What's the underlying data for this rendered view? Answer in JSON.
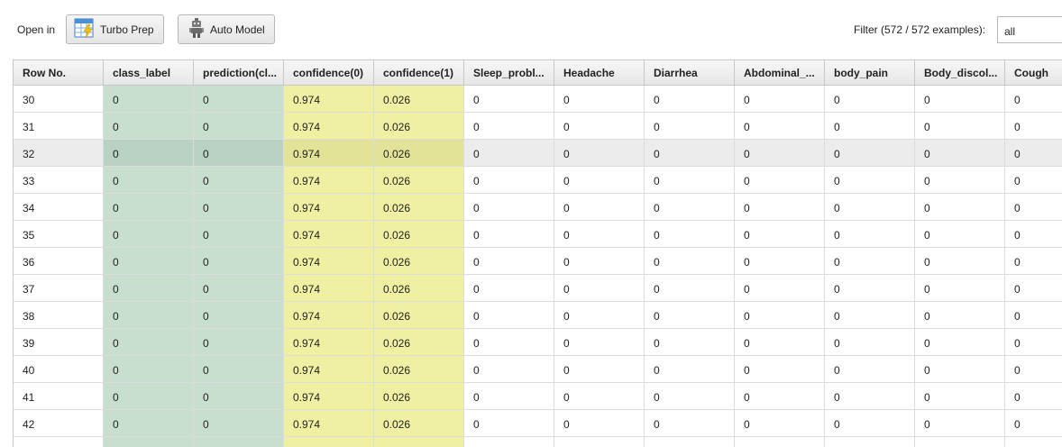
{
  "toolbar": {
    "open_in_label": "Open in",
    "turbo_prep_label": "Turbo Prep",
    "auto_model_label": "Auto Model",
    "filter_label": "Filter (572 / 572 examples):",
    "filter_value": "all"
  },
  "table": {
    "headers": [
      "Row No.",
      "class_label",
      "prediction(cl...",
      "confidence(0)",
      "confidence(1)",
      "Sleep_probl...",
      "Headache",
      "Diarrhea",
      "Abdominal_...",
      "body_pain",
      "Body_discol...",
      "Cough"
    ],
    "rows": [
      [
        "30",
        "0",
        "0",
        "0.974",
        "0.026",
        "0",
        "0",
        "0",
        "0",
        "0",
        "0",
        "0"
      ],
      [
        "31",
        "0",
        "0",
        "0.974",
        "0.026",
        "0",
        "0",
        "0",
        "0",
        "0",
        "0",
        "0"
      ],
      [
        "32",
        "0",
        "0",
        "0.974",
        "0.026",
        "0",
        "0",
        "0",
        "0",
        "0",
        "0",
        "0"
      ],
      [
        "33",
        "0",
        "0",
        "0.974",
        "0.026",
        "0",
        "0",
        "0",
        "0",
        "0",
        "0",
        "0"
      ],
      [
        "34",
        "0",
        "0",
        "0.974",
        "0.026",
        "0",
        "0",
        "0",
        "0",
        "0",
        "0",
        "0"
      ],
      [
        "35",
        "0",
        "0",
        "0.974",
        "0.026",
        "0",
        "0",
        "0",
        "0",
        "0",
        "0",
        "0"
      ],
      [
        "36",
        "0",
        "0",
        "0.974",
        "0.026",
        "0",
        "0",
        "0",
        "0",
        "0",
        "0",
        "0"
      ],
      [
        "37",
        "0",
        "0",
        "0.974",
        "0.026",
        "0",
        "0",
        "0",
        "0",
        "0",
        "0",
        "0"
      ],
      [
        "38",
        "0",
        "0",
        "0.974",
        "0.026",
        "0",
        "0",
        "0",
        "0",
        "0",
        "0",
        "0"
      ],
      [
        "39",
        "0",
        "0",
        "0.974",
        "0.026",
        "0",
        "0",
        "0",
        "0",
        "0",
        "0",
        "0"
      ],
      [
        "40",
        "0",
        "0",
        "0.974",
        "0.026",
        "0",
        "0",
        "0",
        "0",
        "0",
        "0",
        "0"
      ],
      [
        "41",
        "0",
        "0",
        "0.974",
        "0.026",
        "0",
        "0",
        "0",
        "0",
        "0",
        "0",
        "0"
      ],
      [
        "42",
        "0",
        "0",
        "0.974",
        "0.026",
        "0",
        "0",
        "0",
        "0",
        "0",
        "0",
        "0"
      ],
      [
        "",
        "",
        "",
        "",
        "",
        "",
        "",
        "",
        "",
        "",
        "",
        ""
      ]
    ],
    "selected_row": "32",
    "column_colors": {
      "label_prediction": "#c8dfd0",
      "confidence": "#f0f0a2"
    }
  },
  "icons": {
    "turbo_prep": "table-lightning-icon",
    "auto_model": "robot-icon"
  }
}
